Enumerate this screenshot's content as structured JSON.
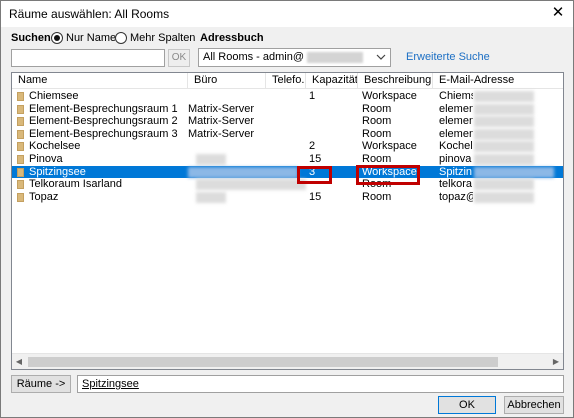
{
  "window": {
    "title": "Räume auswählen: All Rooms",
    "close_glyph": "✕"
  },
  "search": {
    "label": "Suchen:",
    "radio_name": "Nur Name",
    "radio_more": "Mehr Spalten",
    "addressbook_label": "Adressbuch",
    "input_value": "",
    "ok_label": "OK",
    "addressbook_value": "All Rooms - admin@",
    "advanced_link": "Erweiterte Suche"
  },
  "table": {
    "columns": [
      "Name",
      "Büro",
      "Telefo...",
      "Kapazität",
      "Beschreibung",
      "E-Mail-Adresse"
    ],
    "rows": [
      {
        "name": "Chiemsee",
        "buero": "",
        "telefon": "",
        "kapazitaet": "1",
        "beschreibung": "Workspace",
        "email": "Chiems"
      },
      {
        "name": "Element-Besprechungsraum 1",
        "buero": "Matrix-Server",
        "telefon": "",
        "kapazitaet": "",
        "beschreibung": "Room",
        "email": "elemen"
      },
      {
        "name": "Element-Besprechungsraum 2",
        "buero": "Matrix-Server",
        "telefon": "",
        "kapazitaet": "",
        "beschreibung": "Room",
        "email": "elemen"
      },
      {
        "name": "Element-Besprechungsraum 3",
        "buero": "Matrix-Server",
        "telefon": "",
        "kapazitaet": "",
        "beschreibung": "Room",
        "email": "elemen"
      },
      {
        "name": "Kochelsee",
        "buero": "",
        "telefon": "",
        "kapazitaet": "2",
        "beschreibung": "Workspace",
        "email": "Kochel"
      },
      {
        "name": "Pinova",
        "buero": "",
        "telefon": "",
        "kapazitaet": "15",
        "beschreibung": "Room",
        "email": "pinova"
      },
      {
        "name": "Spitzingsee",
        "buero": "",
        "telefon": "",
        "kapazitaet": "3",
        "beschreibung": "Workspace",
        "email": "Spitzin"
      },
      {
        "name": "Telkoraum Isarland",
        "buero": "",
        "telefon": "",
        "kapazitaet": "",
        "beschreibung": "Room",
        "email": "telkora"
      },
      {
        "name": "Topaz",
        "buero": "",
        "telefon": "",
        "kapazitaet": "15",
        "beschreibung": "Room",
        "email": "topaz@"
      }
    ]
  },
  "footer": {
    "rooms_button": "Räume ->",
    "selected_value": "Spitzingsee",
    "ok_label": "OK",
    "cancel_label": "Abbrechen"
  }
}
